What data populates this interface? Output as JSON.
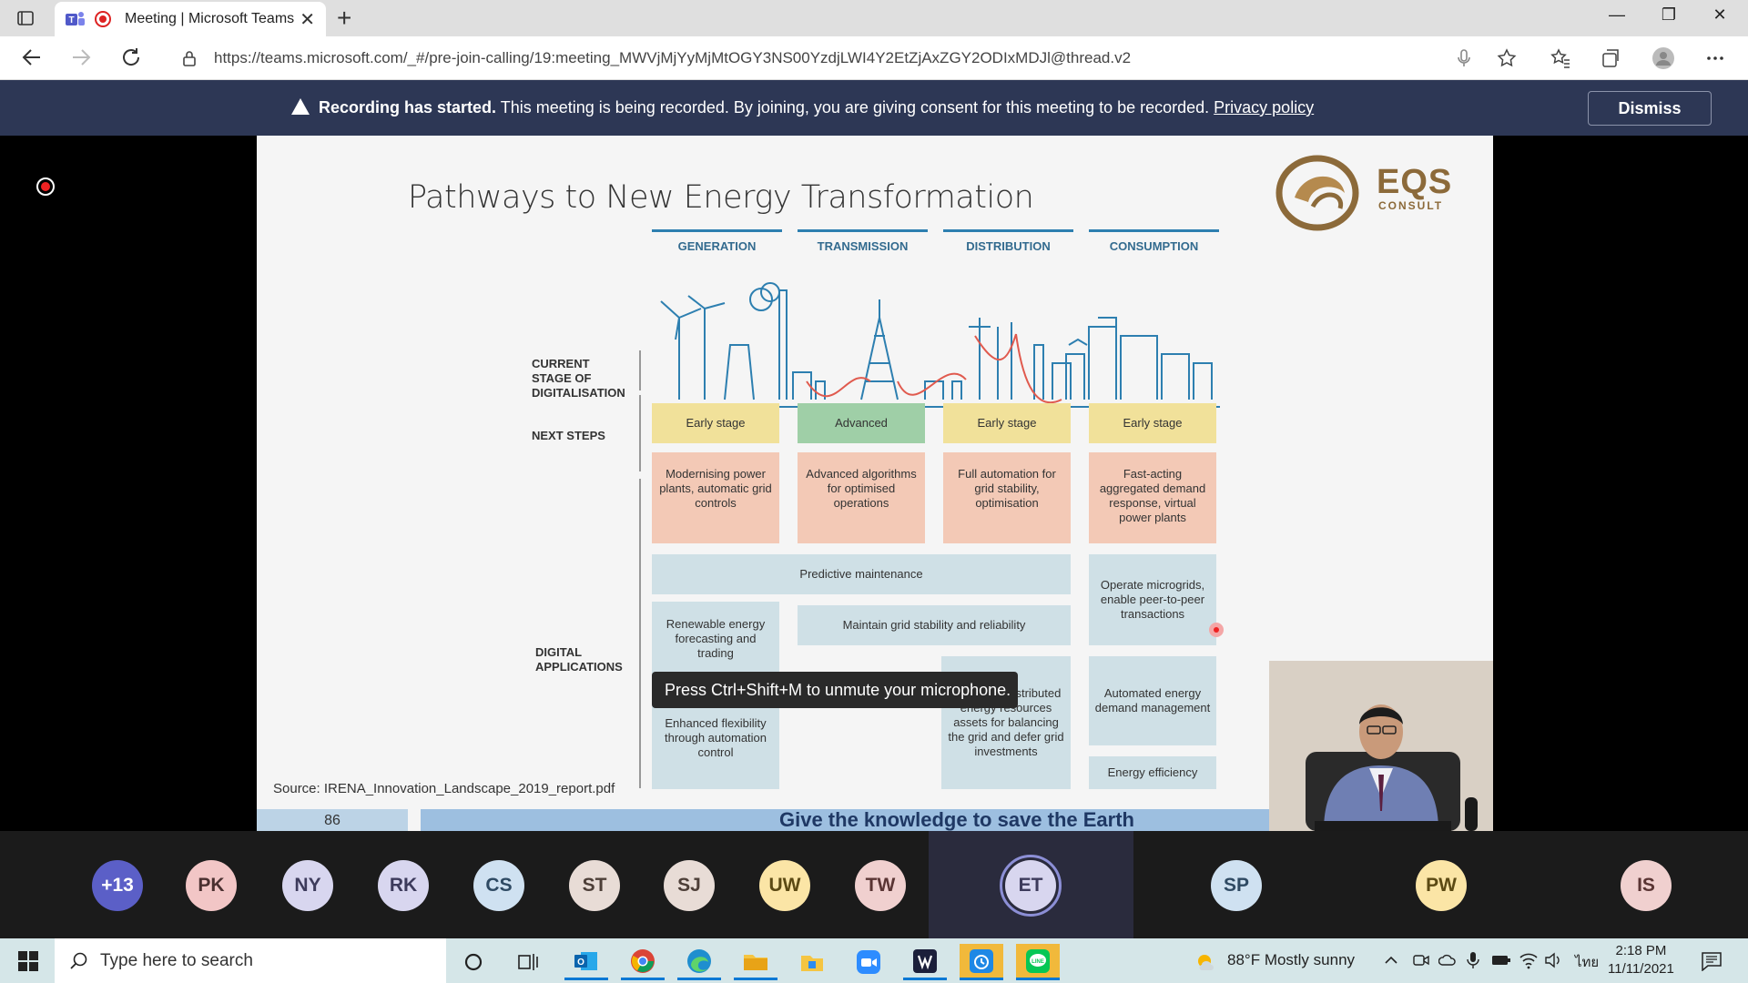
{
  "browser": {
    "tab_title": "Meeting | Microsoft Teams",
    "tab_close": "✕",
    "new_tab": "+",
    "url": "https://teams.microsoft.com/_#/pre-join-calling/19:meeting_MWVjMjYyMjMtOGY3NS00YzdjLWI4Y2EtZjAxZGY2ODIxMDJl@thread.v2",
    "window_controls": [
      "—",
      "❐",
      "✕"
    ]
  },
  "banner": {
    "bold": "Recording has started.",
    "message": " This meeting is being recorded. By joining, you are giving consent for this meeting to be recorded. ",
    "link": "Privacy policy",
    "dismiss_label": "Dismiss"
  },
  "slide": {
    "title": "Pathways to New Energy Transformation",
    "logo_text": "EQS",
    "logo_sub": "CONSULT",
    "columns": [
      "GENERATION",
      "TRANSMISSION",
      "DISTRIBUTION",
      "CONSUMPTION"
    ],
    "row_labels": {
      "stage": [
        "CURRENT",
        "STAGE OF",
        "DIGITALISATION"
      ],
      "next": "NEXT STEPS",
      "apps": [
        "DIGITAL",
        "APPLICATIONS"
      ]
    },
    "stage": [
      "Early stage",
      "Advanced",
      "Early stage",
      "Early stage"
    ],
    "next_steps": [
      "Modernising power plants, automatic grid controls",
      "Advanced algorithms for optimised operations",
      "Full automation for grid stability, optimisation",
      "Fast-acting aggregated demand response, virtual power plants"
    ],
    "apps": {
      "predictive": "Predictive maintenance",
      "microgrids": "Operate microgrids, enable peer-to-peer transactions",
      "renewable": "Renewable energy forecasting and trading",
      "grid_stability": "Maintain grid stability and reliability",
      "flexibility": "Enhanced flexibility through automation control",
      "managing": "Managing distributed energy resources assets for balancing the grid and defer grid investments",
      "demand": "Automated energy demand management",
      "efficiency": "Energy efficiency"
    },
    "source": "Source: IRENA_Innovation_Landscape_2019_report.pdf",
    "page_number": "86",
    "motto": "Give the knowledge to save the Earth"
  },
  "toast": "Press Ctrl+Shift+M to unmute your microphone.",
  "participants": [
    {
      "initials": "+13",
      "bg": "#5b5fc7",
      "fg": "#ffffff"
    },
    {
      "initials": "PK",
      "bg": "#f2c6c6",
      "fg": "#4a3030"
    },
    {
      "initials": "NY",
      "bg": "#d8d6ef",
      "fg": "#3d3b5c"
    },
    {
      "initials": "RK",
      "bg": "#d8d6ef",
      "fg": "#3d3b5c"
    },
    {
      "initials": "CS",
      "bg": "#cfe1f1",
      "fg": "#2f4a63"
    },
    {
      "initials": "ST",
      "bg": "#e8dcd6",
      "fg": "#4d3f38"
    },
    {
      "initials": "SJ",
      "bg": "#e8dcd6",
      "fg": "#4d3f38"
    },
    {
      "initials": "UW",
      "bg": "#fbe5a6",
      "fg": "#5c4a14"
    },
    {
      "initials": "TW",
      "bg": "#f0d0cf",
      "fg": "#5a3534"
    },
    {
      "initials": "ET",
      "bg": "#d8d6ef",
      "fg": "#3d3b5c"
    },
    {
      "initials": "SP",
      "bg": "#cfe1f1",
      "fg": "#2f4a63"
    },
    {
      "initials": "PW",
      "bg": "#fbe5a6",
      "fg": "#5c4a14"
    },
    {
      "initials": "IS",
      "bg": "#f0d0cf",
      "fg": "#5a3534"
    }
  ],
  "taskbar": {
    "search_placeholder": "Type here to search",
    "weather": "88°F  Mostly sunny",
    "language": "ไทย",
    "time": "2:18 PM",
    "date": "11/11/2021"
  }
}
